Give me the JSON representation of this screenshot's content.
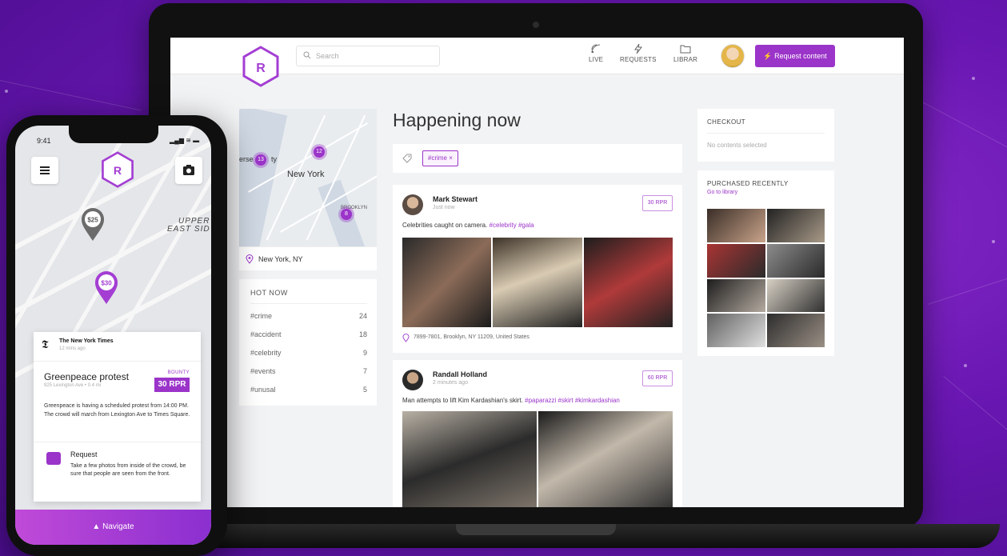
{
  "desktop": {
    "topbar": {
      "search_placeholder": "Search",
      "nav": [
        {
          "label": "LIVE",
          "icon": "live-icon"
        },
        {
          "label": "REQUESTS",
          "icon": "lightning-icon"
        },
        {
          "label": "LIBRAR",
          "icon": "folder-icon"
        }
      ],
      "request_button": "⚡ Request content"
    },
    "map": {
      "city_label": "New York",
      "partial_label": "erse",
      "partial_label_2": "ty",
      "brooklyn_label": "BROOKLYN",
      "clusters": [
        "13",
        "12",
        "8"
      ],
      "location_value": "New York, NY"
    },
    "hot_now": {
      "title": "HOT NOW",
      "rows": [
        {
          "tag": "#crime",
          "count": "24"
        },
        {
          "tag": "#accident",
          "count": "18"
        },
        {
          "tag": "#celebrity",
          "count": "9"
        },
        {
          "tag": "#events",
          "count": "7"
        },
        {
          "tag": "#unusal",
          "count": "5"
        }
      ]
    },
    "feed": {
      "title": "Happening now",
      "filter_chip": "#crime ×",
      "posts": [
        {
          "author": "Mark Stewart",
          "time": "Just now",
          "price": "30 RPR",
          "text": "Celebrities caught on camera.",
          "tags": "#celebrity #gala",
          "location": "7899-7801, Brooklyn, NY 11209, United States"
        },
        {
          "author": "Randall Holland",
          "time": "2 minutes ago",
          "price": "60 RPR",
          "text": "Man attempts to lift Kim Kardashian's skirt.",
          "tags": "#paparazzi #skirt #kimkardashian"
        }
      ]
    },
    "checkout": {
      "title": "CHECKOUT",
      "empty": "No contents selected"
    },
    "purchased": {
      "title": "PURCHASED RECENTLY",
      "link": "Go to library"
    }
  },
  "mobile": {
    "status_time": "9:41",
    "status_icons": "▂▄▆ ≋ ▬",
    "pins": [
      "$25",
      "$30"
    ],
    "map_label_1": "UPPER",
    "map_label_2": "EAST SID",
    "card": {
      "source": "The New York Times",
      "source_time": "12 mins ago",
      "event_title": "Greenpeace protest",
      "event_sub": "925 Lexington Ave • 0.4 mi",
      "bounty_label": "BOUNTY",
      "bounty_value": "30 RPR",
      "description": "Greenpeace is having a scheduled protest from 14:00 PM. The crowd will march from Lexington Ave to Times Square.",
      "request_title": "Request",
      "request_desc": "Take a few photos from inside of the crowd, be sure that people are seen from the front."
    },
    "navigate": "▲ Navigate"
  }
}
